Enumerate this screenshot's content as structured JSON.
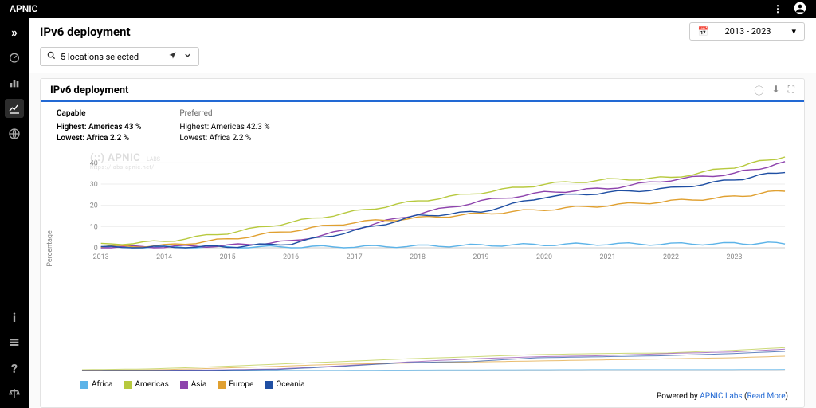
{
  "brand": "APNIC",
  "page_title": "IPv6 deployment",
  "date_range": "2013 - 2023",
  "location_summary": "5 locations selected",
  "panel": {
    "title": "IPv6 deployment",
    "capable": {
      "label": "Capable",
      "highest": "Highest: Americas 43 %",
      "lowest": "Lowest: Africa 2.2 %"
    },
    "preferred": {
      "label": "Preferred",
      "highest": "Highest: Americas 42.3 %",
      "lowest": "Lowest: Africa 2.2 %"
    }
  },
  "ylabel": "Percentage",
  "watermark": "(::) APNIC",
  "watermark_sub": "LABS",
  "watermark_url": "https://labs.apnic.net/",
  "footer": {
    "prefix": "Powered by ",
    "link1": "APNIC Labs",
    "paren_open": " (",
    "link2": "Read More",
    "paren_close": ")"
  },
  "colors": {
    "Africa": "#5cb3e8",
    "Americas": "#b7c93e",
    "Asia": "#8e44ad",
    "Europe": "#e0a030",
    "Oceania": "#1f4fa3"
  },
  "legend": [
    "Africa",
    "Americas",
    "Asia",
    "Europe",
    "Oceania"
  ],
  "chart_data": {
    "type": "line",
    "xlabel": "",
    "ylabel": "Percentage",
    "ylim": [
      0,
      45
    ],
    "title": "IPv6 deployment",
    "x": [
      2013,
      2014,
      2015,
      2016,
      2017,
      2018,
      2019,
      2020,
      2021,
      2022,
      2023,
      2023.8
    ],
    "x_ticks": [
      2013,
      2014,
      2015,
      2016,
      2017,
      2018,
      2019,
      2020,
      2021,
      2022,
      2023
    ],
    "y_ticks": [
      0,
      10,
      20,
      30,
      40
    ],
    "series": [
      {
        "name": "Africa",
        "values": [
          0.1,
          0.2,
          0.3,
          0.4,
          0.5,
          0.8,
          1.2,
          1.5,
          1.8,
          1.8,
          2.0,
          2.2
        ]
      },
      {
        "name": "Americas",
        "values": [
          1.5,
          3,
          7,
          12,
          17,
          22,
          26,
          30,
          32,
          33,
          38,
          43
        ]
      },
      {
        "name": "Asia",
        "values": [
          0.3,
          0.5,
          1,
          3,
          9,
          16,
          22,
          26,
          28,
          32,
          35,
          40
        ]
      },
      {
        "name": "Europe",
        "values": [
          0.5,
          1,
          4,
          8,
          12,
          14,
          16,
          18,
          20,
          22,
          24,
          27
        ]
      },
      {
        "name": "Oceania",
        "values": [
          0.2,
          0.3,
          0.5,
          2,
          8,
          15,
          17,
          24,
          26,
          28,
          32,
          36
        ]
      }
    ]
  }
}
